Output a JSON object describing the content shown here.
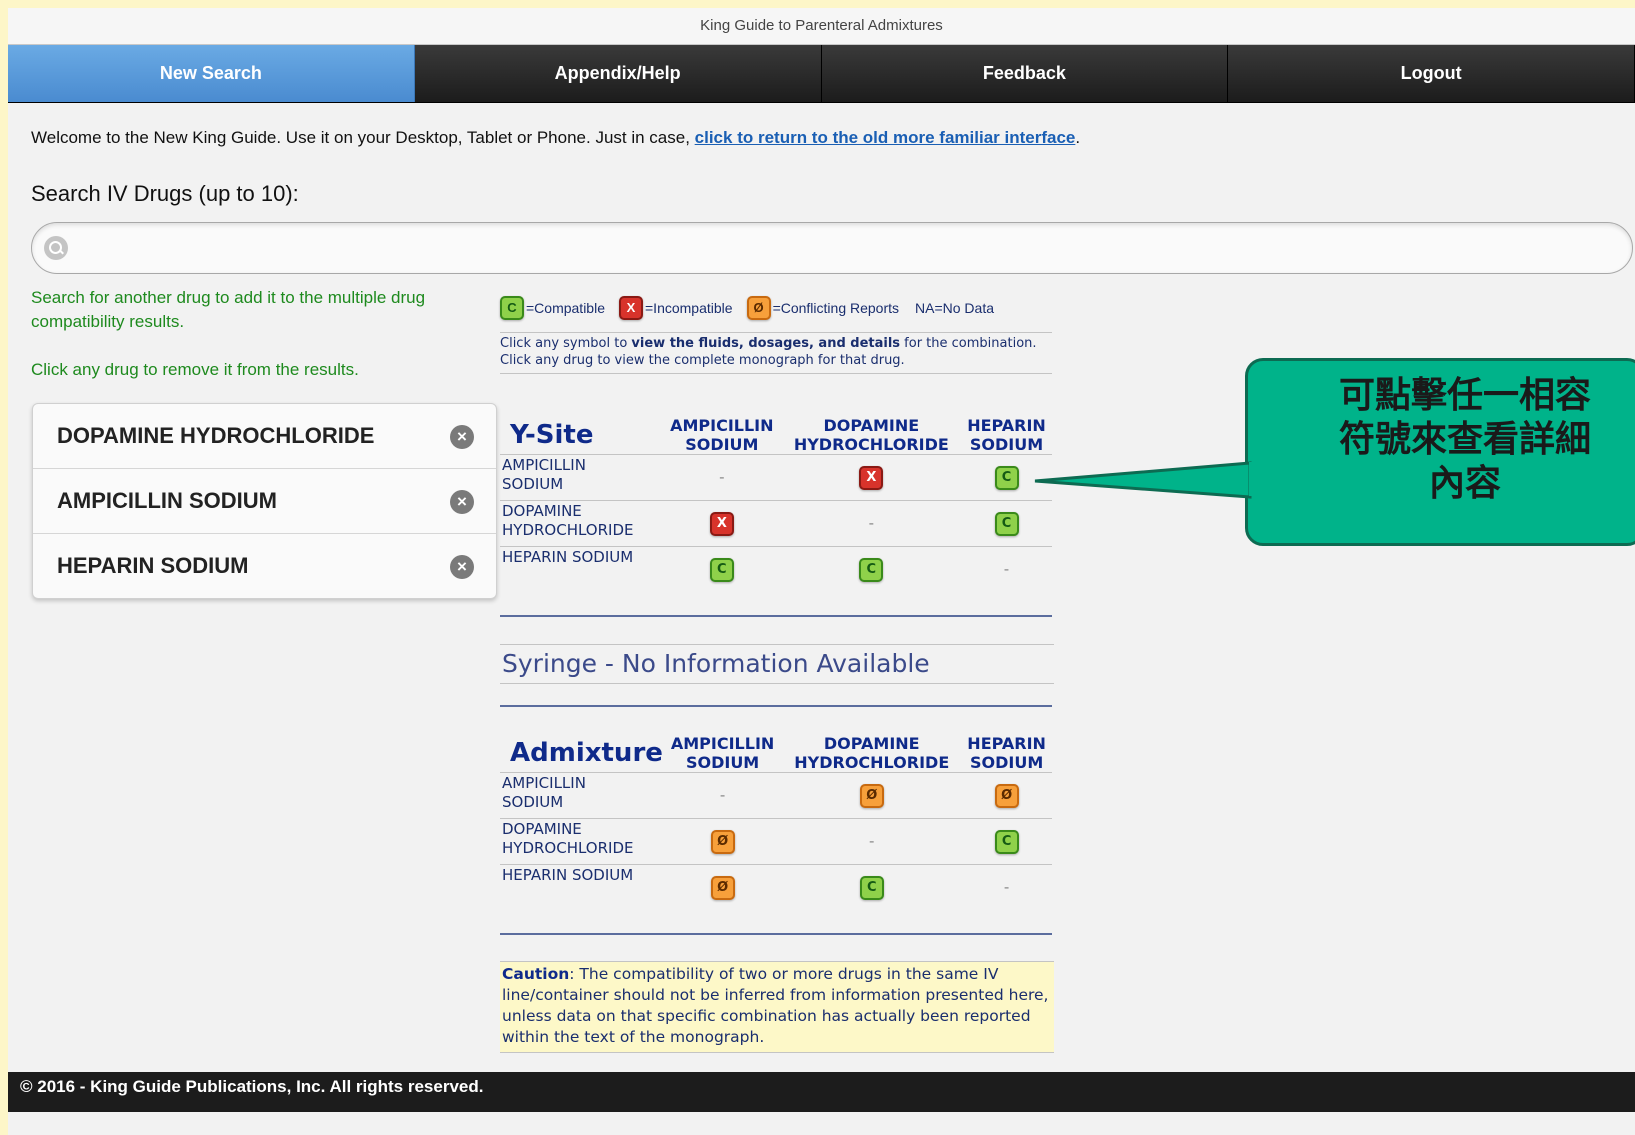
{
  "app": {
    "title": "King Guide to Parenteral Admixtures"
  },
  "nav": [
    {
      "label": "New Search",
      "active": true
    },
    {
      "label": "Appendix/Help",
      "active": false
    },
    {
      "label": "Feedback",
      "active": false
    },
    {
      "label": "Logout",
      "active": false
    }
  ],
  "welcome": {
    "text": "Welcome to the New King Guide. Use it on your Desktop, Tablet or Phone. Just in case, ",
    "link": "click to return to the old more familiar interface",
    "after": "."
  },
  "search": {
    "label": "Search IV Drugs (up to 10):",
    "value": "",
    "placeholder": ""
  },
  "hints": {
    "add": "Search for another drug to add it to the multiple drug compatibility results.",
    "remove": "Click any drug to remove it from the results."
  },
  "selected_drugs": [
    "DOPAMINE HYDROCHLORIDE",
    "AMPICILLIN SODIUM",
    "HEPARIN SODIUM"
  ],
  "legend": {
    "compatible": "=Compatible",
    "incompatible": "=Incompatible",
    "conflicting": "=Conflicting Reports",
    "nodata": "NA=No Data",
    "symbols": {
      "C": "C",
      "X": "X",
      "O": "Ø"
    }
  },
  "help": {
    "line1_pre": "Click any symbol to ",
    "line1_bold": "view the fluids, dosages, and details",
    "line1_post": " for the combination.",
    "line2": "Click any drug to view the complete monograph for that drug."
  },
  "ysite": {
    "title": "Y-Site",
    "columns": [
      {
        "l1": "AMPICILLIN",
        "l2": "SODIUM"
      },
      {
        "l1": "DOPAMINE",
        "l2": "HYDROCHLORIDE"
      },
      {
        "l1": "HEPARIN",
        "l2": "SODIUM"
      }
    ],
    "rows": [
      {
        "l1": "AMPICILLIN",
        "l2": "SODIUM",
        "cells": [
          "-",
          "X",
          "C"
        ]
      },
      {
        "l1": "DOPAMINE",
        "l2": "HYDROCHLORIDE",
        "cells": [
          "X",
          "-",
          "C"
        ]
      },
      {
        "l1": "HEPARIN SODIUM",
        "l2": "",
        "cells": [
          "C",
          "C",
          "-"
        ]
      }
    ]
  },
  "syringe": {
    "text": "Syringe - No Information Available"
  },
  "admixture": {
    "title": "Admixture",
    "columns": [
      {
        "l1": "AMPICILLIN",
        "l2": "SODIUM"
      },
      {
        "l1": "DOPAMINE",
        "l2": "HYDROCHLORIDE"
      },
      {
        "l1": "HEPARIN",
        "l2": "SODIUM"
      }
    ],
    "rows": [
      {
        "l1": "AMPICILLIN",
        "l2": "SODIUM",
        "cells": [
          "-",
          "O",
          "O"
        ]
      },
      {
        "l1": "DOPAMINE",
        "l2": "HYDROCHLORIDE",
        "cells": [
          "O",
          "-",
          "C"
        ]
      },
      {
        "l1": "HEPARIN SODIUM",
        "l2": "",
        "cells": [
          "O",
          "C",
          "-"
        ]
      }
    ]
  },
  "caution": {
    "label": "Caution",
    "text": ": The compatibility of two or more drugs in the same IV line/container should not be inferred from information presented here, unless data on that specific combination has actually been reported within the text of the monograph."
  },
  "callout": {
    "text": "可點擊任一相容\n符號來查看詳細\n內容"
  },
  "footer": {
    "text": "© 2016 - King Guide Publications, Inc. All rights reserved."
  },
  "colors": {
    "accent": "#4a8bd0",
    "navbar": "#1d1d1d",
    "compatible": "#8fd14a",
    "incompatible": "#d8332b",
    "conflicting": "#f7a03b",
    "callout": "#00b38a"
  }
}
